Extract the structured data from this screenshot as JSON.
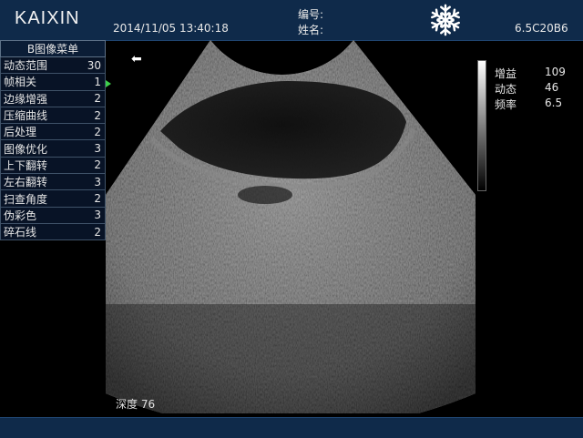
{
  "header": {
    "brand": "KAIXIN",
    "datetime": "2014/11/05  13:40:18",
    "id_label": "编号:",
    "name_label": "姓名:",
    "probe": "6.5C20B6",
    "freeze_icon": "snowflake-icon"
  },
  "menu": {
    "title": "B图像菜单",
    "items": [
      {
        "label": "动态范围",
        "value": "30"
      },
      {
        "label": "帧相关",
        "value": "1"
      },
      {
        "label": "边缘增强",
        "value": "2"
      },
      {
        "label": "压缩曲线",
        "value": "2"
      },
      {
        "label": "后处理",
        "value": "2"
      },
      {
        "label": "图像优化",
        "value": "3"
      },
      {
        "label": "上下翻转",
        "value": "2"
      },
      {
        "label": "左右翻转",
        "value": "3"
      },
      {
        "label": "扫查角度",
        "value": "2"
      },
      {
        "label": "伪彩色",
        "value": "3"
      },
      {
        "label": "碎石线",
        "value": "2"
      }
    ]
  },
  "image": {
    "orientation_icon": "left-arrow-icon",
    "orientation_glyph": "⬅",
    "depth_label": "深度 76"
  },
  "params": [
    {
      "label": "增益",
      "value": "109"
    },
    {
      "label": "动态",
      "value": "46"
    },
    {
      "label": "频率",
      "value": "6.5"
    }
  ],
  "colors": {
    "bar": "#0f2a4a",
    "menu_bg": "#081326",
    "marker": "#3dd04b"
  }
}
